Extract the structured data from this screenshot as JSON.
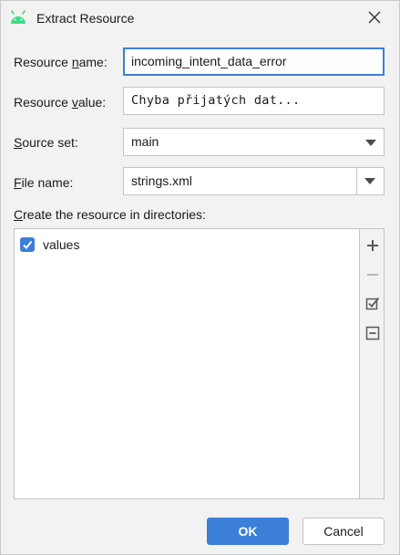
{
  "window": {
    "title": "Extract Resource",
    "app_icon": "android-icon",
    "close_icon": "close-icon"
  },
  "form": {
    "resource_name": {
      "label_pre": "Resource ",
      "label_mnemonic": "n",
      "label_post": "ame:",
      "value": "incoming_intent_data_error"
    },
    "resource_value": {
      "label_pre": "Resource ",
      "label_mnemonic": "v",
      "label_post": "alue:",
      "value": "Chyba přijatých dat..."
    },
    "source_set": {
      "label_pre": "",
      "label_mnemonic": "S",
      "label_post": "ource set:",
      "value": "main"
    },
    "file_name": {
      "label_pre": "",
      "label_mnemonic": "F",
      "label_post": "ile name:",
      "value": "strings.xml"
    }
  },
  "directories": {
    "label_pre": "",
    "label_mnemonic": "C",
    "label_post": "reate the resource in directories:",
    "items": [
      {
        "label": "values",
        "checked": true
      }
    ],
    "toolbar": [
      "plus-icon",
      "minus-icon",
      "check-all-icon",
      "collapse-icon"
    ]
  },
  "buttons": {
    "ok": "OK",
    "cancel": "Cancel"
  },
  "colors": {
    "accent": "#3b7fd9",
    "android_green": "#3ddc84"
  }
}
